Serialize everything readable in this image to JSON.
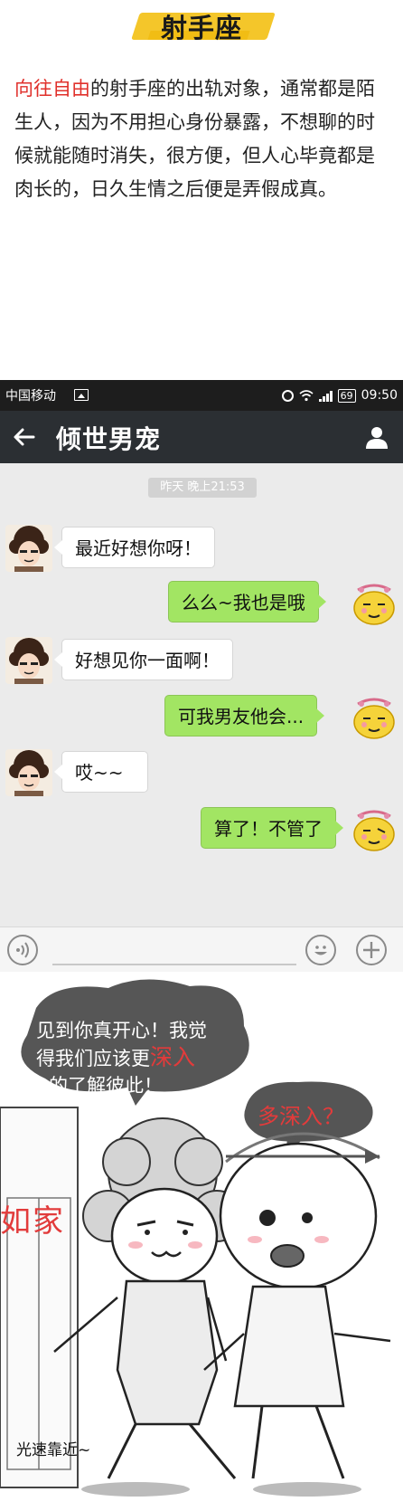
{
  "header": {
    "title": "射手座",
    "paragraph_highlight": "向往自由",
    "paragraph_rest": "的射手座的出轨对象，通常都是陌生人，因为不用担心身份暴露，不想聊的时候就能随时消失，很方便，但人心毕竟都是肉长的，日久生情之后便是弄假成真。"
  },
  "status_bar": {
    "carrier": "中国移动",
    "battery": "69",
    "time": "09:50"
  },
  "chat": {
    "title": "倾世男宠",
    "timestamp": "昨天 晚上21:53",
    "messages": [
      {
        "side": "left",
        "text": "最近好想你呀！"
      },
      {
        "side": "right",
        "text": "么么~我也是哦"
      },
      {
        "side": "left",
        "text": "好想见你一面啊！"
      },
      {
        "side": "right",
        "text": "可我男友他会..."
      },
      {
        "side": "left",
        "text": "哎~~"
      },
      {
        "side": "right",
        "text": "算了！不管了"
      }
    ]
  },
  "comic": {
    "speech_line1": "见到你真开心！我觉",
    "speech_line2_a": "得我们应该更",
    "speech_line2_b": "深入",
    "speech_line3": "的了解彼此！",
    "reply": "多深入？",
    "sign": "如家",
    "caption": "光速靠近~"
  },
  "colors": {
    "accent_red": "#e0302b",
    "brush_yellow": "#f4c62a",
    "bubble_green": "#a2e563",
    "navbar": "#2b2f33"
  },
  "icons": [
    "image-icon",
    "alarm-icon",
    "wifi-icon",
    "signal-icon",
    "back-arrow-icon",
    "contact-icon",
    "voice-icon",
    "emoji-icon",
    "plus-icon"
  ]
}
